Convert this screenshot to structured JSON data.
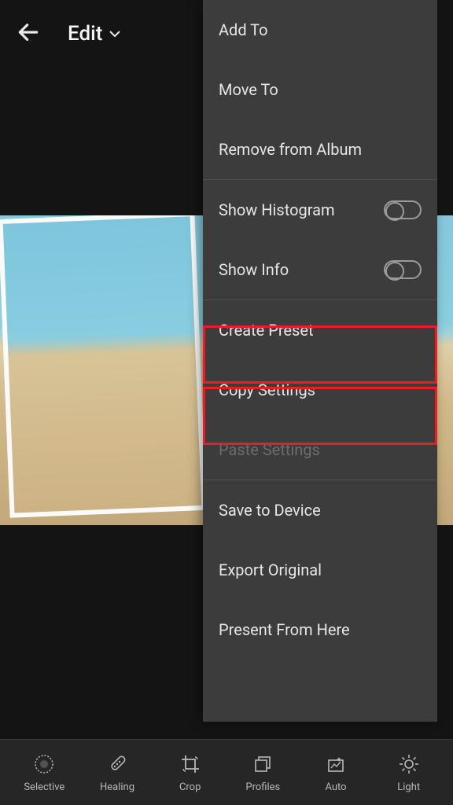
{
  "header": {
    "title": "Edit"
  },
  "menu": {
    "add_to": "Add To",
    "move_to": "Move To",
    "remove_from_album": "Remove from Album",
    "show_histogram": "Show Histogram",
    "show_info": "Show Info",
    "create_preset": "Create Preset",
    "copy_settings": "Copy Settings",
    "paste_settings": "Paste Settings",
    "save_to_device": "Save to Device",
    "export_original": "Export Original",
    "present_from_here": "Present From Here"
  },
  "toggles": {
    "show_histogram": false,
    "show_info": false
  },
  "tools": {
    "selective": "Selective",
    "healing": "Healing",
    "crop": "Crop",
    "profiles": "Profiles",
    "auto": "Auto",
    "light": "Light"
  }
}
